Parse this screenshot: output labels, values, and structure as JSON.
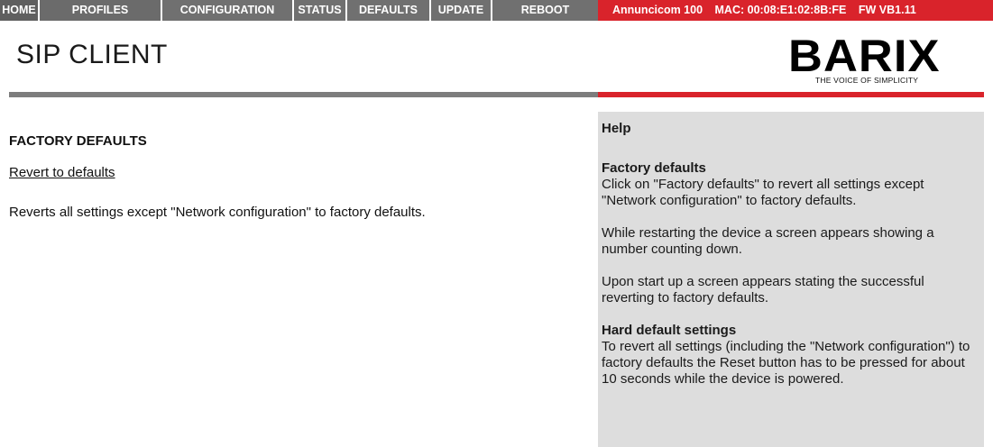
{
  "nav": {
    "home": "HOME",
    "profiles": "PROFILES",
    "configuration": "CONFIGURATION",
    "status": "STATUS",
    "defaults": "DEFAULTS",
    "update": "UPDATE",
    "reboot": "REBOOT"
  },
  "device": {
    "model": "Annuncicom 100",
    "mac": "MAC: 00:08:E1:02:8B:FE",
    "firmware": "FW VB1.11"
  },
  "header": {
    "title": "SIP CLIENT",
    "logo_word": "BARIX",
    "logo_tagline": "THE VOICE OF SIMPLICITY"
  },
  "main": {
    "heading": "FACTORY DEFAULTS",
    "revert_link": "Revert to defaults",
    "revert_description": "Reverts all settings except \"Network configuration\" to factory defaults."
  },
  "help": {
    "title": "Help",
    "factory_title": "Factory defaults",
    "factory_text": "Click on \"Factory defaults\" to revert all settings except \"Network configuration\" to factory defaults.",
    "restart_text": "While restarting the device a screen appears showing a number counting down.",
    "startup_text": "Upon start up a screen appears stating the successful reverting to factory defaults.",
    "hard_title": "Hard default settings",
    "hard_text": "To revert all settings (including the \"Network configuration\") to factory defaults the Reset button has to be pressed for about 10 seconds while the device is powered."
  },
  "colors": {
    "brand_red": "#d9232b",
    "nav_grey": "#707070",
    "help_bg": "#dddddd"
  }
}
